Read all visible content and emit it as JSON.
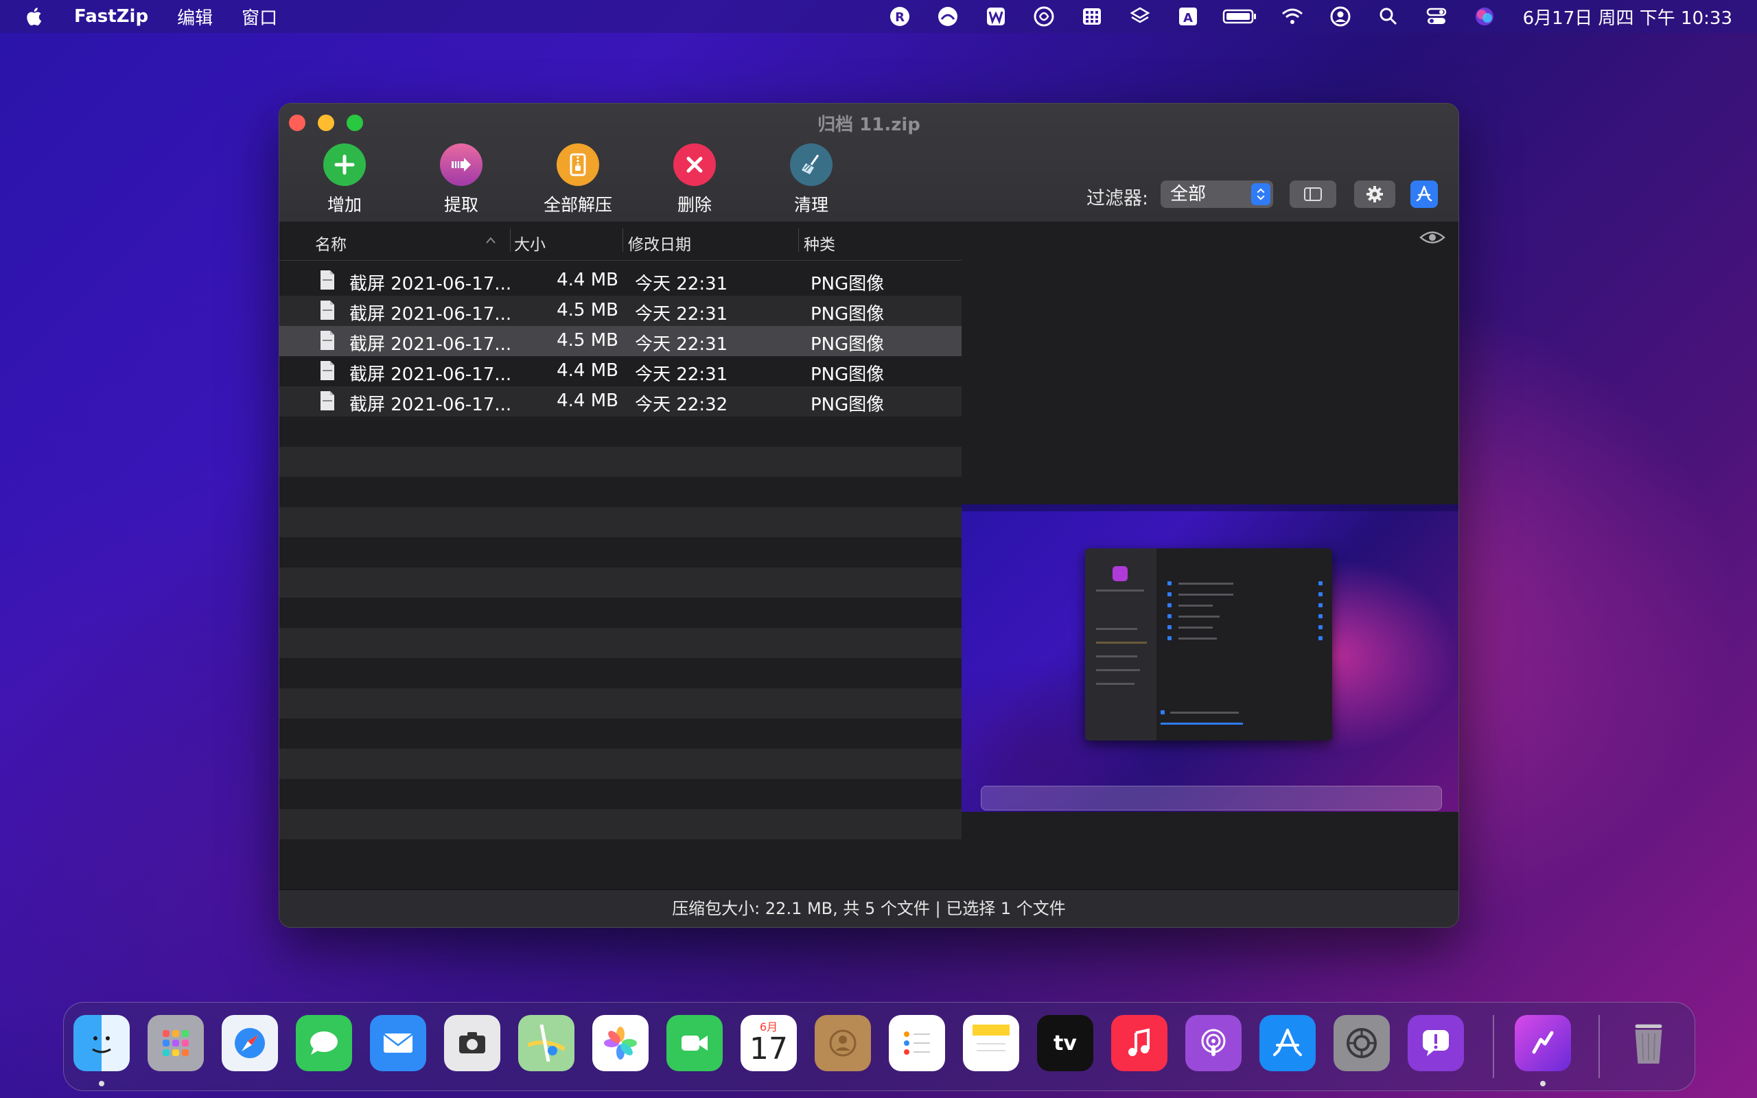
{
  "menubar": {
    "app_name": "FastZip",
    "menus": [
      "编辑",
      "窗口"
    ],
    "clock": "6月17日 周四 下午 10:33",
    "tray_icons": [
      "r-circle-icon",
      "face-icon",
      "w-square-icon",
      "fan-icon",
      "grid-icon",
      "layers-icon",
      "a-square-icon",
      "battery-icon",
      "wifi-icon",
      "user-circle-icon",
      "search-icon",
      "control-center-icon",
      "siri-icon"
    ]
  },
  "window": {
    "title": "归档 11.zip",
    "toolbar": {
      "add": "增加",
      "extract": "提取",
      "extract_all": "全部解压",
      "delete": "删除",
      "clean": "清理",
      "filter_label": "过滤器:",
      "filter_value": "全部"
    },
    "columns": {
      "name": "名称",
      "size": "大小",
      "date": "修改日期",
      "kind": "种类"
    },
    "files": [
      {
        "name": "截屏 2021-06-17...",
        "size": "4.4 MB",
        "date": "今天 22:31",
        "kind": "PNG图像"
      },
      {
        "name": "截屏 2021-06-17...",
        "size": "4.5 MB",
        "date": "今天 22:31",
        "kind": "PNG图像"
      },
      {
        "name": "截屏 2021-06-17...",
        "size": "4.5 MB",
        "date": "今天 22:31",
        "kind": "PNG图像"
      },
      {
        "name": "截屏 2021-06-17...",
        "size": "4.4 MB",
        "date": "今天 22:31",
        "kind": "PNG图像"
      },
      {
        "name": "截屏 2021-06-17...",
        "size": "4.4 MB",
        "date": "今天 22:32",
        "kind": "PNG图像"
      }
    ],
    "selected_index": 2,
    "status": "压缩包大小: 22.1 MB, 共 5 个文件 | 已选择 1 个文件"
  },
  "dock": {
    "apps": [
      "Finder",
      "Launchpad",
      "Safari",
      "Messages",
      "Mail",
      "Screenshot",
      "Maps",
      "Photos",
      "FaceTime",
      "Calendar",
      "Contacts",
      "Reminders",
      "Notes",
      "TV",
      "Music",
      "Podcasts",
      "App Store",
      "System Preferences",
      "Feedback Assistant",
      "FastZip",
      "Trash"
    ],
    "calendar_month": "6月",
    "calendar_day": "17",
    "tv_label": "tv"
  },
  "colors": {
    "accent": "#2f7cf6",
    "window_bg": "#1e1e21",
    "selection": "#46464a"
  }
}
